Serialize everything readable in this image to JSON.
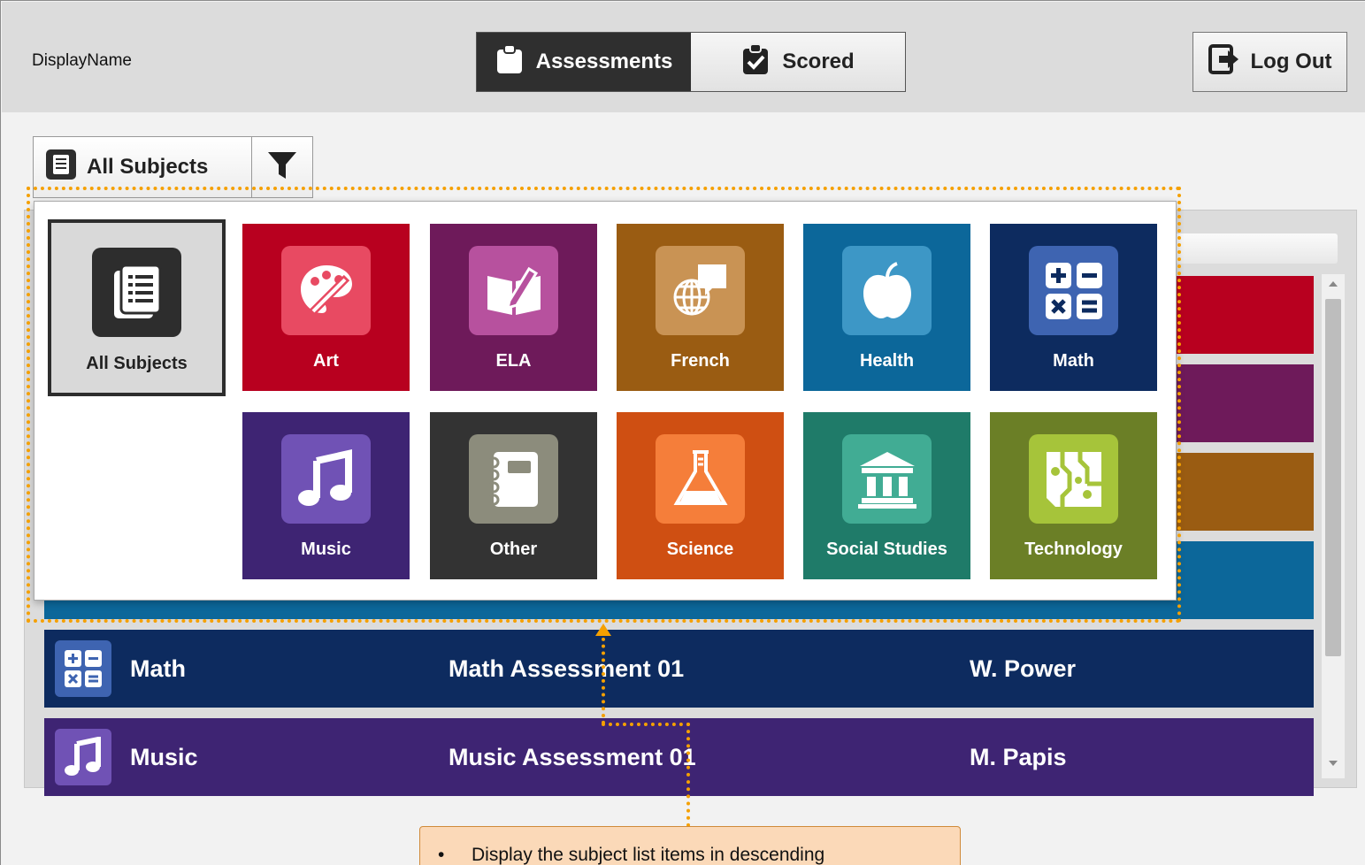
{
  "header": {
    "display_name": "DisplayName",
    "tabs": [
      {
        "label": "Assessments",
        "active": true
      },
      {
        "label": "Scored",
        "active": false
      }
    ],
    "logout_label": "Log Out"
  },
  "selector": {
    "current": "All Subjects"
  },
  "subjects": {
    "all_label": "All Subjects",
    "tiles": [
      {
        "label": "Art",
        "icon": "palette-icon",
        "color": "#b8001f",
        "icon_color": "#e84a62"
      },
      {
        "label": "ELA",
        "icon": "book-pencil-icon",
        "color": "#6e1a5a",
        "icon_color": "#b7519e"
      },
      {
        "label": "French",
        "icon": "globe-speech-icon",
        "color": "#9a5c12",
        "icon_color": "#c99354"
      },
      {
        "label": "Health",
        "icon": "apple-icon",
        "color": "#0c679a",
        "icon_color": "#3d97c6"
      },
      {
        "label": "Math",
        "icon": "calculator-icon",
        "color": "#0d2b5f",
        "icon_color": "#3e64b1"
      },
      {
        "label": "Music",
        "icon": "music-note-icon",
        "color": "#3e2473",
        "icon_color": "#7052b5"
      },
      {
        "label": "Other",
        "icon": "notebook-icon",
        "color": "#333333",
        "icon_color": "#8c8c7c"
      },
      {
        "label": "Science",
        "icon": "flask-icon",
        "color": "#cf4f12",
        "icon_color": "#f57e3a"
      },
      {
        "label": "Social Studies",
        "icon": "museum-icon",
        "color": "#1f7b69",
        "icon_color": "#41ac94"
      },
      {
        "label": "Technology",
        "icon": "circuit-icon",
        "color": "#6b7f26",
        "icon_color": "#a6c43a"
      }
    ]
  },
  "rows": [
    {
      "subject": "Math",
      "title": "Math Assessment 01",
      "teacher": "W. Power",
      "color": "#0d2b5f",
      "icon_color": "#3e64b1"
    },
    {
      "subject": "Music",
      "title": "Music Assessment 01",
      "teacher": "M. Papis",
      "color": "#3e2473",
      "icon_color": "#7052b5"
    }
  ],
  "background_row_colors": [
    "#b8001f",
    "#6e1a5a",
    "#9a5c12",
    "#0c679a"
  ],
  "annotation": {
    "note_text": "Display the subject list items in descending",
    "accent": "#f5a000"
  }
}
